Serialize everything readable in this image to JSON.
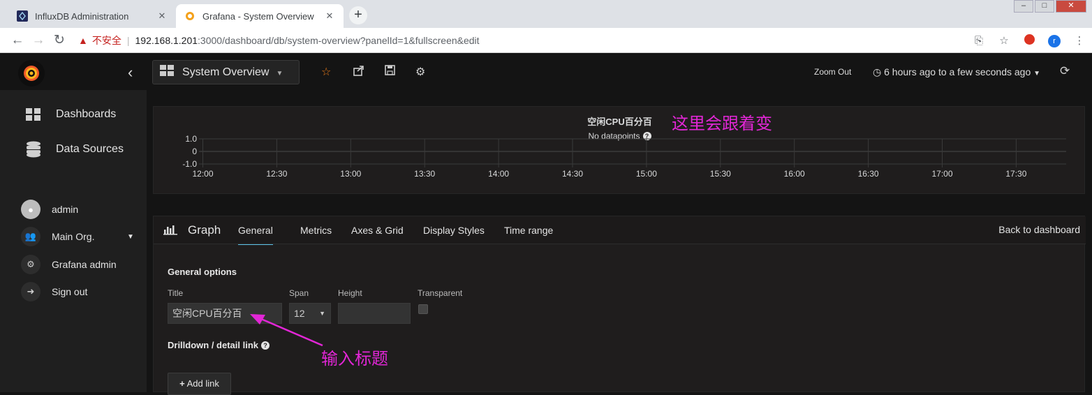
{
  "browser": {
    "tabs": [
      {
        "title": "InfluxDB Administration",
        "active": false
      },
      {
        "title": "Grafana - System Overview",
        "active": true
      }
    ],
    "url": {
      "security_label": "不安全",
      "host": "192.168.1.201",
      "rest": ":3000/dashboard/db/system-overview?panelId=1&fullscreen&edit"
    },
    "profile_initial": "r"
  },
  "sidebar": {
    "menu": [
      {
        "label": "Dashboards",
        "icon": "dashboards-icon"
      },
      {
        "label": "Data Sources",
        "icon": "database-icon"
      }
    ],
    "user": [
      {
        "label": "admin",
        "icon": "user-avatar"
      },
      {
        "label": "Main Org.",
        "icon": "users-icon"
      },
      {
        "label": "Grafana admin",
        "icon": "cog-icon"
      },
      {
        "label": "Sign out",
        "icon": "sign-out-icon"
      }
    ]
  },
  "topnav": {
    "dashboard_title": "System Overview",
    "zoom_out": "Zoom Out",
    "time_range": "6 hours ago to a few seconds ago"
  },
  "panel": {
    "title": "空闲CPU百分百",
    "no_data": "No datapoints"
  },
  "annotations": {
    "panel_note": "这里会跟着变",
    "input_note": "输入标题"
  },
  "editor": {
    "type_label": "Graph",
    "tabs": [
      "General",
      "Metrics",
      "Axes & Grid",
      "Display Styles",
      "Time range"
    ],
    "active_tab": "General",
    "back_link": "Back to dashboard",
    "general_options": "General options",
    "labels": {
      "title": "Title",
      "span": "Span",
      "height": "Height",
      "transparent": "Transparent"
    },
    "values": {
      "title": "空闲CPU百分百",
      "span": "12",
      "height": ""
    },
    "drilldown": "Drilldown / detail link",
    "add_link": "Add link"
  },
  "chart_data": {
    "type": "line",
    "title": "空闲CPU百分百",
    "x_tick_labels": [
      "12:00",
      "12:30",
      "13:00",
      "13:30",
      "14:00",
      "14:30",
      "15:00",
      "15:30",
      "16:00",
      "16:30",
      "17:00",
      "17:30"
    ],
    "y_tick_labels": [
      "1.0",
      "0",
      "-1.0"
    ],
    "ylim": [
      -1.0,
      1.0
    ],
    "series": [],
    "grid": true
  }
}
